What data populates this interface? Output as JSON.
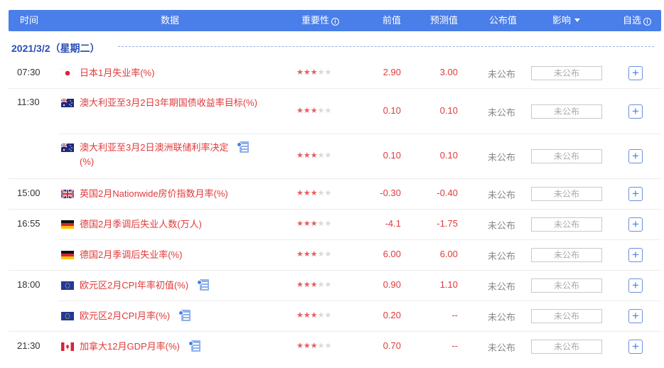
{
  "header": {
    "time": "时间",
    "data": "数据",
    "importance": "重要性",
    "previous": "前值",
    "forecast": "预测值",
    "actual": "公布值",
    "influence": "影响",
    "favorite": "自选"
  },
  "date_label": "2021/3/2（星期二）",
  "colors": {
    "header_bg": "#4a7ee8",
    "event_red": "#e03a3a",
    "star_on": "#e55d5d"
  },
  "events": [
    {
      "time": "07:30",
      "flag": "japan-flag",
      "name": "日本1月失业率(%)",
      "has_doc": false,
      "stars": 3,
      "previous": "2.90",
      "forecast": "3.00",
      "actual": "未公布",
      "influence": "未公布",
      "add": "+"
    },
    {
      "time": "11:30",
      "flag": "australia-flag",
      "name": "澳大利亚至3月2日3年期国债收益率目标(%)",
      "has_doc": false,
      "stars": 3,
      "previous": "0.10",
      "forecast": "0.10",
      "actual": "未公布",
      "influence": "未公布",
      "add": "+"
    },
    {
      "time": "",
      "flag": "australia-flag",
      "name": "澳大利亚至3月2日澳洲联储利率决定(%)",
      "has_doc": true,
      "stars": 3,
      "previous": "0.10",
      "forecast": "0.10",
      "actual": "未公布",
      "influence": "未公布",
      "add": "+"
    },
    {
      "time": "15:00",
      "flag": "uk-flag",
      "name": "英国2月Nationwide房价指数月率(%)",
      "has_doc": false,
      "stars": 3,
      "previous": "-0.30",
      "forecast": "-0.40",
      "actual": "未公布",
      "influence": "未公布",
      "add": "+"
    },
    {
      "time": "16:55",
      "flag": "germany-flag",
      "name": "德国2月季调后失业人数(万人)",
      "has_doc": false,
      "stars": 3,
      "previous": "-4.1",
      "forecast": "-1.75",
      "actual": "未公布",
      "influence": "未公布",
      "add": "+"
    },
    {
      "time": "",
      "flag": "germany-flag",
      "name": "德国2月季调后失业率(%)",
      "has_doc": false,
      "stars": 3,
      "previous": "6.00",
      "forecast": "6.00",
      "actual": "未公布",
      "influence": "未公布",
      "add": "+"
    },
    {
      "time": "18:00",
      "flag": "eu-flag",
      "name": "欧元区2月CPI年率初值(%)",
      "has_doc": true,
      "stars": 3,
      "previous": "0.90",
      "forecast": "1.10",
      "actual": "未公布",
      "influence": "未公布",
      "add": "+"
    },
    {
      "time": "",
      "flag": "eu-flag",
      "name": "欧元区2月CPI月率(%)",
      "has_doc": true,
      "stars": 3,
      "previous": "0.20",
      "forecast": "--",
      "actual": "未公布",
      "influence": "未公布",
      "add": "+"
    },
    {
      "time": "21:30",
      "flag": "canada-flag",
      "name": "加拿大12月GDP月率(%)",
      "has_doc": true,
      "stars": 3,
      "previous": "0.70",
      "forecast": "--",
      "actual": "未公布",
      "influence": "未公布",
      "add": "+"
    }
  ]
}
